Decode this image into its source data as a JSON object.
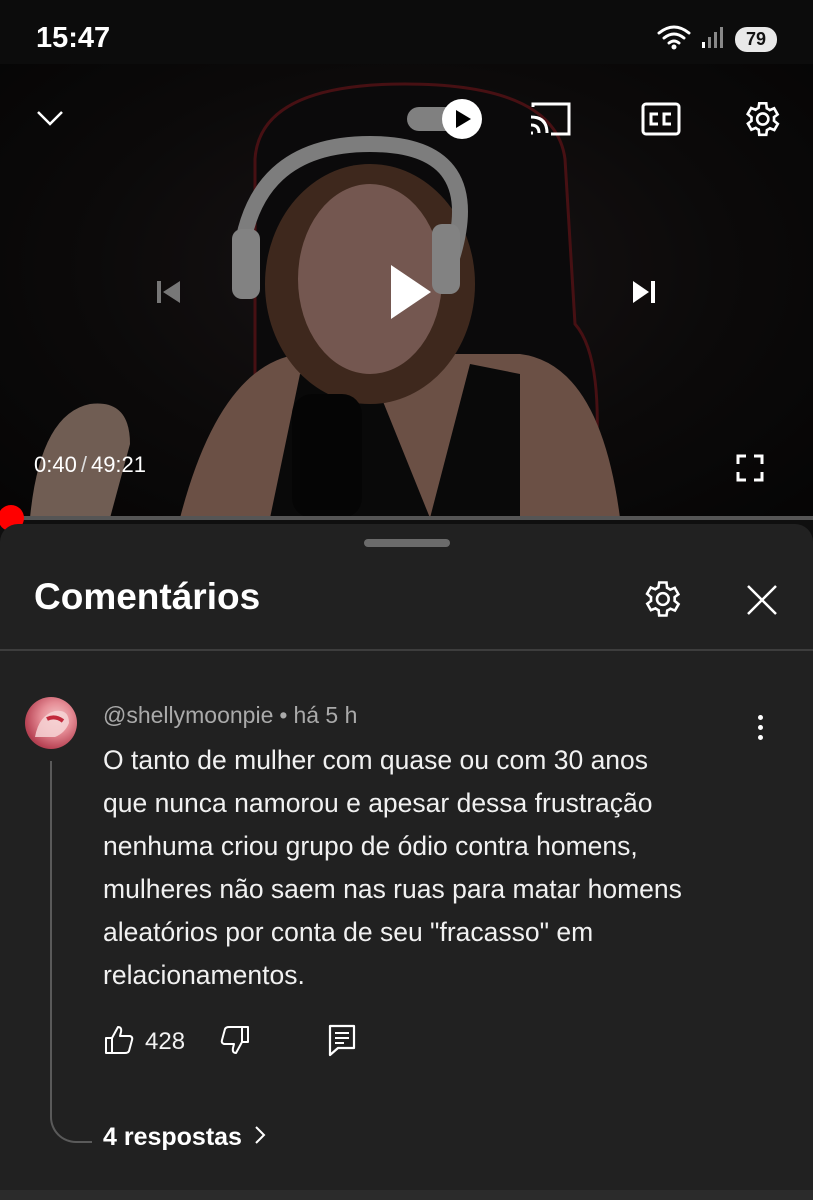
{
  "status_bar": {
    "time": "15:47",
    "battery": "79",
    "icons": [
      "wifi-icon",
      "signal-icon",
      "battery-icon"
    ]
  },
  "player": {
    "current_time": "0:40",
    "separator": "/",
    "duration": "49:21",
    "progress_fraction": 0.0135,
    "autoplay_on": true,
    "controls": [
      "collapse-chevron-icon",
      "autoplay-toggle",
      "cast-icon",
      "captions-icon",
      "settings-icon",
      "previous-icon",
      "play-icon",
      "next-icon",
      "fullscreen-icon"
    ],
    "accent_color": "#ff0000"
  },
  "comments_panel": {
    "title": "Comentários",
    "icons": [
      "settings-icon",
      "close-icon"
    ]
  },
  "comment": {
    "author": "@shellymoonpie",
    "age": "há 5 h",
    "text": "O tanto de mulher com quase ou com 30 anos\nque nunca namorou e apesar dessa frustração\nnenhuma criou grupo de ódio contra homens,\nmulheres não saem nas ruas para matar homens\naleatórios por conta de seu \"fracasso\" em\nrelacionamentos.",
    "likes": "428",
    "replies_label": "4 respostas"
  }
}
